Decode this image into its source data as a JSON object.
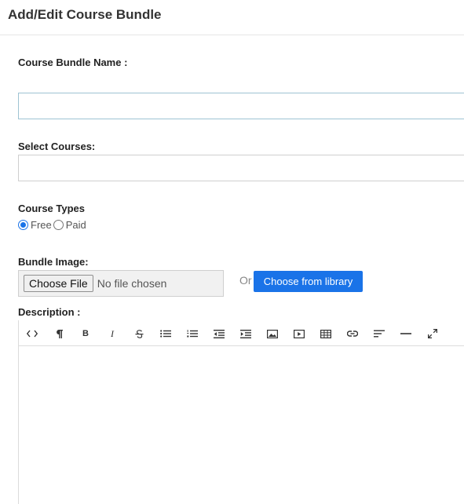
{
  "header": {
    "title": "Add/Edit Course Bundle"
  },
  "form": {
    "bundle_name": {
      "label": "Course Bundle Name :",
      "value": ""
    },
    "select_courses": {
      "label": "Select Courses:"
    },
    "course_types": {
      "label": "Course Types",
      "options": [
        {
          "label": "Free",
          "checked": true
        },
        {
          "label": "Paid",
          "checked": false
        }
      ]
    },
    "bundle_image": {
      "label": "Bundle Image:",
      "choose_file": "Choose File",
      "status": "No file chosen",
      "or": "Or",
      "library_button": "Choose from library"
    },
    "description": {
      "label": "Description :"
    }
  },
  "toolbar": {
    "buttons": [
      "code-view-icon",
      "paragraph-icon",
      "bold-icon",
      "italic-icon",
      "strikethrough-icon",
      "unordered-list-icon",
      "ordered-list-icon",
      "outdent-icon",
      "indent-icon",
      "image-icon",
      "video-icon",
      "table-icon",
      "link-icon",
      "align-icon",
      "horizontal-rule-icon",
      "fullscreen-icon"
    ]
  },
  "colors": {
    "accent": "#1a73e8",
    "input_border": "#9ec3d3"
  }
}
